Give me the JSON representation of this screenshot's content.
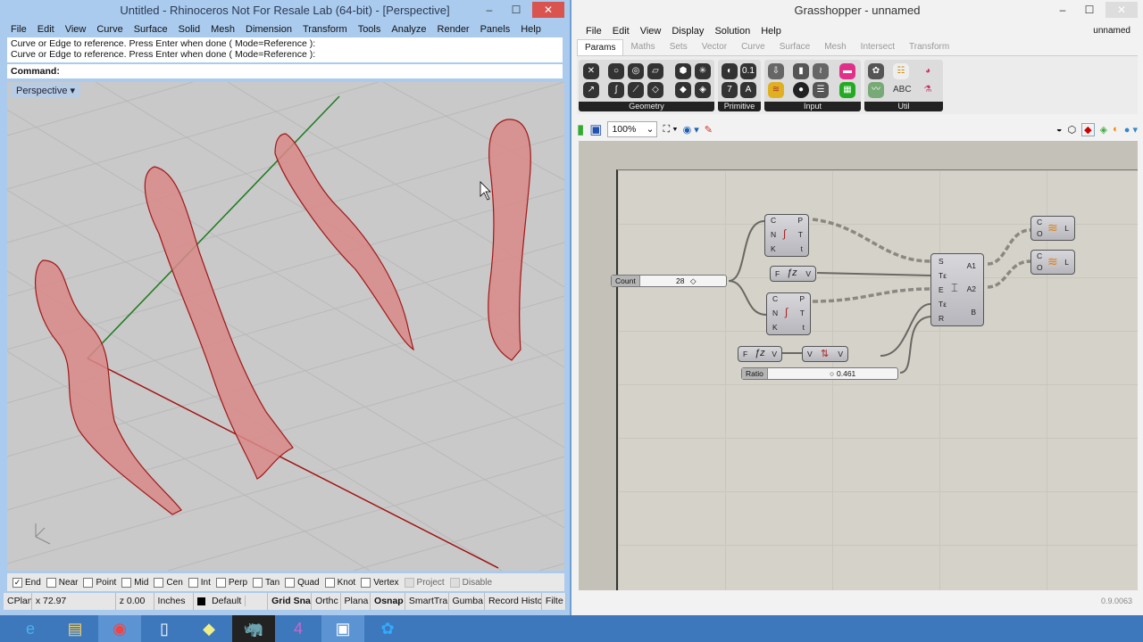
{
  "rhino": {
    "title": "Untitled - Rhinoceros Not For Resale Lab (64-bit) - [Perspective]",
    "menu": [
      "File",
      "Edit",
      "View",
      "Curve",
      "Surface",
      "Solid",
      "Mesh",
      "Dimension",
      "Transform",
      "Tools",
      "Analyze",
      "Render",
      "Panels",
      "Help"
    ],
    "history": [
      "Curve or Edge to reference. Press Enter when done ( Mode=Reference ):",
      "Curve or Edge to reference. Press Enter when done ( Mode=Reference ):"
    ],
    "command_label": "Command:",
    "viewport_label": "Perspective",
    "osnaps": [
      {
        "label": "End",
        "checked": true
      },
      {
        "label": "Near",
        "checked": false
      },
      {
        "label": "Point",
        "checked": false
      },
      {
        "label": "Mid",
        "checked": false
      },
      {
        "label": "Cen",
        "checked": false
      },
      {
        "label": "Int",
        "checked": false
      },
      {
        "label": "Perp",
        "checked": false
      },
      {
        "label": "Tan",
        "checked": false
      },
      {
        "label": "Quad",
        "checked": false
      },
      {
        "label": "Knot",
        "checked": false
      },
      {
        "label": "Vertex",
        "checked": false
      },
      {
        "label": "Project",
        "checked": false,
        "disabled": true
      },
      {
        "label": "Disable",
        "checked": false,
        "disabled": true
      }
    ],
    "status": {
      "cplane": "CPlan",
      "x": "x 72.97",
      "z": "z 0.00",
      "units": "Inches",
      "layer": "Default",
      "panes": [
        "Grid Sna",
        "Orthc",
        "Plana",
        "Osnap",
        "SmartTra",
        "Gumba",
        "Record Histc",
        "Filte"
      ]
    }
  },
  "gh": {
    "title": "Grasshopper - unnamed",
    "menu": [
      "File",
      "Edit",
      "View",
      "Display",
      "Solution",
      "Help"
    ],
    "doc_name": "unnamed",
    "tabs": [
      "Params",
      "Maths",
      "Sets",
      "Vector",
      "Curve",
      "Surface",
      "Mesh",
      "Intersect",
      "Transform"
    ],
    "groups": [
      "Geometry",
      "Primitive",
      "Input",
      "Util"
    ],
    "zoom": "100%",
    "slider_count": {
      "label": "Count",
      "value": "28"
    },
    "slider_ratio": {
      "label": "Ratio",
      "value": "0.461"
    },
    "version": "0.9.0063"
  }
}
